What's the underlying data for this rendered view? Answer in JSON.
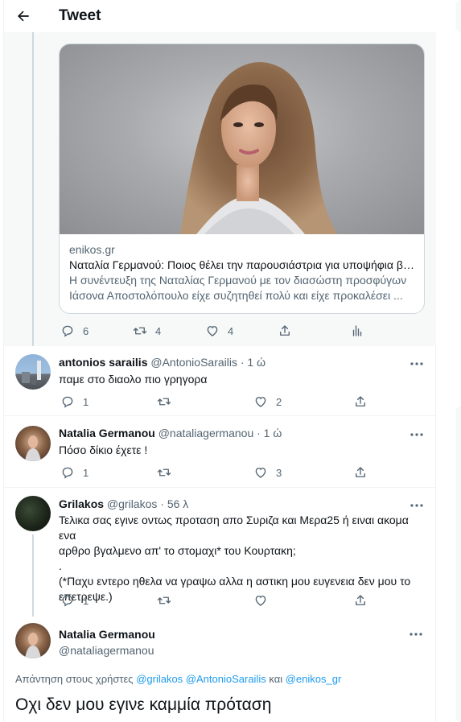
{
  "header": {
    "title": "Tweet",
    "back_icon": "arrow-left-icon"
  },
  "colors": {
    "accent": "#1d9bf0",
    "secondary_text": "#536471",
    "like_red": "#f91880"
  },
  "link_card": {
    "domain": "enikos.gr",
    "title": "Ναταλία Γερμανού: Ποιος θέλει την παρουσιάστρια για υποψήφια βο...",
    "description": "Η συνέντευξη της Ναταλίας Γερμανού με τον διασώστη προσφύγων Ιάσονα Αποστολόπουλο είχε συζητηθεί πολύ και είχε προκαλέσει ..."
  },
  "parent_actions": {
    "replies": "6",
    "retweets": "4",
    "likes": "4"
  },
  "replies": [
    {
      "name": "antonios sarailis",
      "handle": "@AntonioSarailis",
      "time": "· 1 ώ",
      "text": "παμε στο διαολο πιο γρηγορα",
      "replies": "1",
      "retweets": "",
      "likes": "2"
    },
    {
      "name": "Natalia Germanou",
      "handle": "@nataliagermanou",
      "time": "· 1 ώ",
      "text": "Πόσο δίκιο έχετε !",
      "replies": "1",
      "retweets": "",
      "likes": "3"
    },
    {
      "name": "Grilakos",
      "handle": "@grilakos",
      "time": "· 56 λ",
      "text_lines": [
        "Τελικα σας εγινε οντως προταση απο Συριζα και Μερα25 ή ειναι ακομα ενα",
        "αρθρο βγαλμενο απ' το στομαχι* του Κουρτακη;",
        ".",
        "(*Παχυ εντερο ηθελα να γραψω αλλα η αστικη μου ευγενεια δεν μου το",
        "επετρεψε.)"
      ],
      "replies": "1",
      "retweets": "",
      "likes": ""
    }
  ],
  "main_tweet": {
    "name": "Natalia Germanou",
    "handle": "@nataliagermanou",
    "replying_prefix": "Απάντηση στους χρήστες",
    "mention_1": "@grilakos",
    "mention_2": "@AntonioSarailis",
    "replying_and": "και",
    "mention_3": "@enikos_gr",
    "text": "Οχι δεν μου εγινε καμμία πρόταση"
  }
}
